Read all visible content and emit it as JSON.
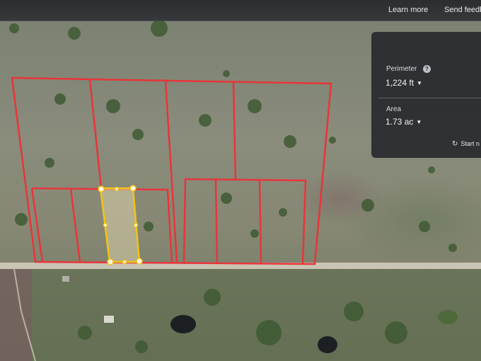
{
  "topbar": {
    "learn_more": "Learn more",
    "send_feedback": "Send feedba"
  },
  "measure_panel": {
    "perimeter_label": "Perimeter",
    "perimeter_value": "1,224 ft",
    "area_label": "Area",
    "area_value": "1.73 ac",
    "restart_label": "Start n"
  },
  "icons": {
    "help": "help-circle-icon",
    "dropdown": "caret-down-icon",
    "restart": "restart-icon",
    "pegman": "person-icon",
    "layers": "globe-icon"
  },
  "colors": {
    "parcel_outline": "#e8353a",
    "selection_outline": "#f2c318",
    "panel_bg": "#2b2d31"
  }
}
